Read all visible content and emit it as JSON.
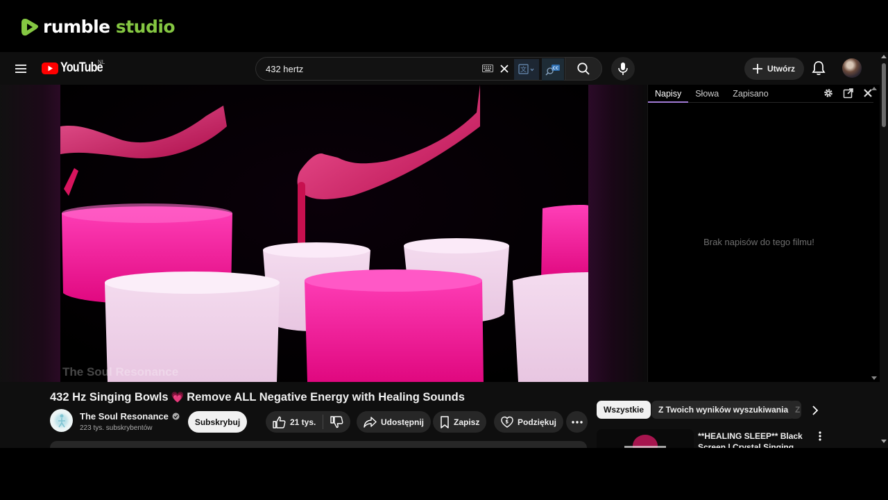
{
  "rumble": {
    "brand_a": "rumble",
    "brand_b": "studio",
    "color": "#85c742"
  },
  "masthead": {
    "logo_text": "YouTube",
    "country_code": "NL",
    "search_value": "432 hertz",
    "create_label": "Utwórz"
  },
  "video": {
    "watermark": "The Soul Resonance",
    "title_part1": "432 Hz Singing Bowls",
    "title_emoji": "💗",
    "title_part2": "Remove ALL Negative Energy with Healing Sounds",
    "channel_name": "The Soul Resonance",
    "channel_subs": "223 tys. subskrybentów",
    "subscribe_label": "Subskrybuj",
    "likes": "21 tys.",
    "share_label": "Udostępnij",
    "save_label": "Zapisz",
    "thanks_label": "Podziękuj"
  },
  "subtitles_panel": {
    "tabs": [
      "Napisy",
      "Słowa",
      "Zapisano"
    ],
    "empty_text": "Brak napisów do tego filmu!"
  },
  "related": {
    "chips": [
      "Wszystkie",
      "Z Twoich wyników wyszukiwania"
    ],
    "chip_partial": "Z",
    "first_title": "**HEALING SLEEP** Black Screen | Crystal Singing Bowls"
  },
  "colors": {
    "accent_pink": "#e6007e",
    "bg": "#0f0f0f",
    "youtube_red": "#ff0000"
  }
}
